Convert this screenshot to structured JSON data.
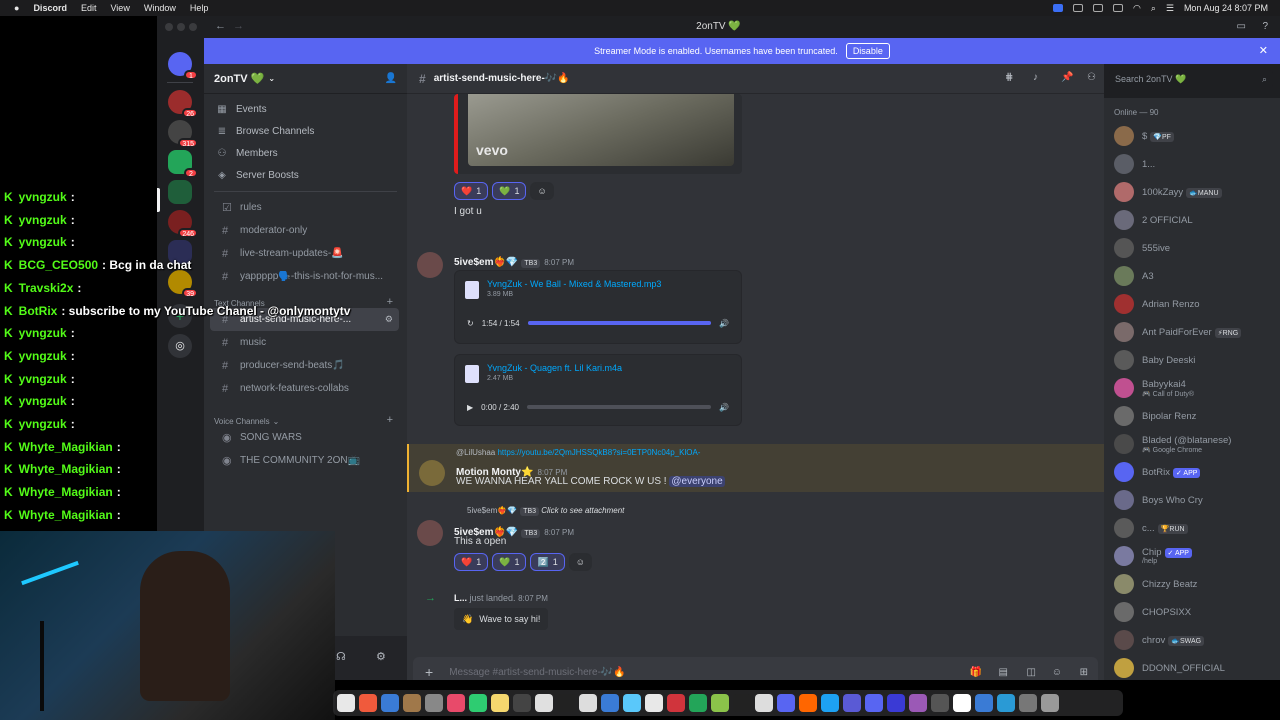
{
  "menubar": {
    "app": "Discord",
    "items": [
      "Edit",
      "View",
      "Window",
      "Help"
    ],
    "datetime": "Mon Aug 24  8:07 PM"
  },
  "window": {
    "title": "2onTV 💚"
  },
  "banner": {
    "text": "Streamer Mode is enabled. Usernames have been truncated.",
    "button": "Disable"
  },
  "rail": {
    "badges": [
      "1",
      "26",
      "315",
      "2",
      "246",
      "39"
    ]
  },
  "server": {
    "name": "2onTV 💚"
  },
  "nav": [
    {
      "label": "Events",
      "icon": "calendar-icon"
    },
    {
      "label": "Browse Channels",
      "icon": "browse-icon"
    },
    {
      "label": "Members",
      "icon": "members-icon"
    },
    {
      "label": "Server Boosts",
      "icon": "boost-icon"
    }
  ],
  "channels": [
    {
      "label": "rules",
      "type": "rules"
    },
    {
      "label": "moderator-only",
      "type": "text"
    },
    {
      "label": "live-stream-updates-🚨",
      "type": "text"
    },
    {
      "label": "yappppp🗣️-this-is-not-for-mus...",
      "type": "text"
    }
  ],
  "text_category": "Text Channels",
  "text_channels": [
    {
      "label": "artist-send-music-here-...",
      "selected": true
    },
    {
      "label": "music"
    },
    {
      "label": "producer-send-beats🎵"
    },
    {
      "label": "network-features-collabs"
    }
  ],
  "voice_category": "Voice Channels",
  "voice_channels": [
    {
      "label": "SONG WARS"
    },
    {
      "label": "THE COMMUNITY 2ON📺"
    }
  ],
  "chat": {
    "channel": "artist-send-music-here-🎶🔥",
    "search_placeholder": "Search 2onTV 💚",
    "video_label": "vevo",
    "msg0": {
      "reactions": [
        {
          "emoji": "❤️",
          "count": "1"
        },
        {
          "emoji": "💚",
          "count": "1"
        }
      ],
      "text": "I got u"
    },
    "msg1": {
      "user": "5ive$em❤️‍🔥💎",
      "tag": "TB3",
      "time": "8:07 PM",
      "file1": {
        "name": "YvngZuk - We Ball - Mixed & Mastered.mp3",
        "size": "3.89 MB",
        "time": "1:54 / 1:54",
        "progress": 1.0
      },
      "file2": {
        "name": "YvngZuk - Quagen ft. Lil Kari.m4a",
        "size": "2.47 MB",
        "time": "0:00 / 2:40",
        "progress": 0.0
      }
    },
    "msg2": {
      "reply_user": "@LilUshaa",
      "reply_link": "https://youtu.be/2QmJHSSQkB8?si=0ETP0Nc04p_KlOA-",
      "user": "Motion Monty⭐",
      "time": "8:07 PM",
      "text": "WE WANNA HEAR YALL COME ROCK W US !",
      "mention": "@everyone"
    },
    "msg3": {
      "reply_user": "5ive$em❤️‍🔥💎",
      "reply_tag": "TB3",
      "reply_text": "Click to see attachment",
      "user": "5ive$em❤️‍🔥💎",
      "tag": "TB3",
      "time": "8:07 PM",
      "text": "This a open",
      "reactions": [
        {
          "emoji": "❤️",
          "count": "1"
        },
        {
          "emoji": "💚",
          "count": "1"
        },
        {
          "emoji": "2️⃣",
          "count": "1"
        }
      ]
    },
    "msg4": {
      "user": "L...",
      "text": "just landed.",
      "time": "8:07 PM",
      "wave": "Wave to say hi!"
    },
    "composer_placeholder": "Message #artist-send-music-here-🎶🔥"
  },
  "members": {
    "header": "Online — 90",
    "list": [
      {
        "name": "$",
        "tag": "💎PF"
      },
      {
        "name": "1..."
      },
      {
        "name": "100kZayy",
        "tag": "🐟MANU"
      },
      {
        "name": "2 OFFICIAL"
      },
      {
        "name": "555ive"
      },
      {
        "name": "A3"
      },
      {
        "name": "Adrian Renzo"
      },
      {
        "name": "Ant PaidForEver",
        "tag": "⚡RNG"
      },
      {
        "name": "Baby Deeski"
      },
      {
        "name": "Babyykai4",
        "sub": "🎮 Call of Duty®"
      },
      {
        "name": "Bipolar Renz"
      },
      {
        "name": "Bladed (@blatanese)",
        "sub": "🎮 Google Chrome"
      },
      {
        "name": "BotRix",
        "app": "✓ APP"
      },
      {
        "name": "Boys Who Cry"
      },
      {
        "name": "c...",
        "tag": "🏆RUN"
      },
      {
        "name": "Chip",
        "app": "✓ APP",
        "sub": "/help"
      },
      {
        "name": "Chizzy Beatz"
      },
      {
        "name": "CHOPSIXX"
      },
      {
        "name": "chrov",
        "tag": "🐟SWAG"
      },
      {
        "name": "DDONN_OFFICIAL"
      }
    ]
  },
  "overlay": [
    {
      "name": "yvngzuk",
      "text": ":"
    },
    {
      "name": "yvngzuk",
      "text": ":"
    },
    {
      "name": "yvngzuk",
      "text": ":"
    },
    {
      "name": "BCG_CEO500",
      "text": ": Bcg in da chat"
    },
    {
      "name": "Travski2x",
      "text": ":"
    },
    {
      "name": "BotRix",
      "text": ": subscribe to my YouTube Chanel - @onlymontytv"
    },
    {
      "name": "yvngzuk",
      "text": ":"
    },
    {
      "name": "yvngzuk",
      "text": ":"
    },
    {
      "name": "yvngzuk",
      "text": ":"
    },
    {
      "name": "yvngzuk",
      "text": ":"
    },
    {
      "name": "yvngzuk",
      "text": ":"
    },
    {
      "name": "Whyte_Magikian",
      "text": ":"
    },
    {
      "name": "Whyte_Magikian",
      "text": ":"
    },
    {
      "name": "Whyte_Magikian",
      "text": ":"
    },
    {
      "name": "Whyte_Magikian",
      "text": ":"
    }
  ]
}
